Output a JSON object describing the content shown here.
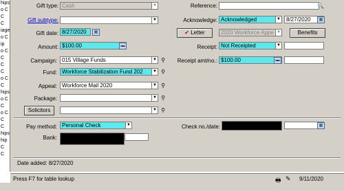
{
  "left_edge": [
    "hips",
    "o C",
    "C",
    "C",
    "iage",
    "o C",
    "ip",
    "o C",
    "C",
    "C",
    "C",
    "o C",
    "C",
    "hips",
    "o C",
    "C",
    "o C",
    "C",
    "C",
    "hips",
    "hip",
    "C",
    "C"
  ],
  "form": {
    "gift_type": {
      "label": "Gift type:",
      "value": "Cash"
    },
    "gift_subtype": {
      "label": "Gift subtype:",
      "value": ""
    },
    "gift_date": {
      "label": "Gift date:",
      "value": "8/27/2020"
    },
    "amount": {
      "label": "Amount:",
      "value": "$100.00"
    },
    "campaign": {
      "label": "Campaign:",
      "value": "015 Village Funds"
    },
    "fund": {
      "label": "Fund:",
      "value": "Workforce Stabilization Fund 202"
    },
    "appeal": {
      "label": "Appeal:",
      "value": "Workforce Mail 2020"
    },
    "package": {
      "label": "Package:",
      "value": ""
    },
    "solicitors": {
      "label": "Solicitors",
      "value": ""
    },
    "reference": {
      "label": "Reference:",
      "value": ""
    },
    "acknowledge": {
      "label": "Acknowledge:",
      "value": "Acknowledged",
      "date": "8/27/2020"
    },
    "letter": {
      "label": "Letter",
      "value": "2020 Workforce Appe"
    },
    "benefits": {
      "label": "Benefits"
    },
    "receipt": {
      "label": "Receipt:",
      "value": "Not Receipted",
      "date": ""
    },
    "receipt_amt": {
      "label": "Receipt amt/no.:",
      "value": "$100.00",
      "no": ""
    },
    "pay_method": {
      "label": "Pay method:",
      "value": "Personal Check"
    },
    "bank": {
      "label": "Bank:",
      "value": ""
    },
    "check_no_date": {
      "label": "Check no./date:",
      "value": "",
      "date": ""
    },
    "date_added": "Date added:  8/27/2020"
  },
  "status_bar": {
    "hint": "Press F7 for table lookup",
    "date": "9/11/2020"
  }
}
